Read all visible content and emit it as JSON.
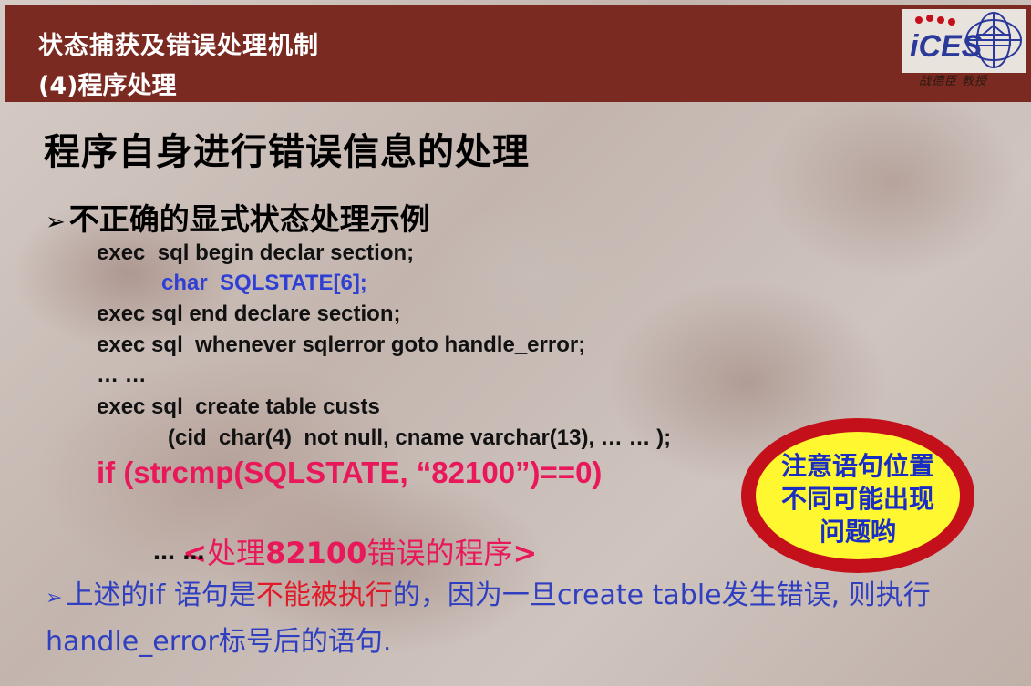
{
  "header": {
    "title": "状态捕获及错误处理机制",
    "subtitle": "(4)程序处理",
    "logo_text": "iCES",
    "logo_caption": "战德臣 教授"
  },
  "main_title": "程序自身进行错误信息的处理",
  "subheading": {
    "arrow": "➢",
    "text": "不正确的显式状态处理示例"
  },
  "code_lines": [
    "exec  sql begin declar section;",
    "char  SQLSTATE[6];",
    "exec sql end declare section;",
    "exec sql  whenever sqlerror goto handle_error;",
    "… …",
    "exec sql  create table custs",
    "(cid  char(4)  not null, cname varchar(13), … … );"
  ],
  "if_line": "if (strcmp(SQLSTATE, “82100”)==0)",
  "handler": {
    "open": "<",
    "part1": "处理",
    "code": "82100",
    "part2": "错误的程序",
    "close": ">"
  },
  "ellipsis": "… …",
  "callout": {
    "line1": "注意语句位置",
    "line2": "不同可能出现",
    "line3": "问题哟"
  },
  "note": {
    "arrow": "➢",
    "part1": "上述的if 语句是",
    "red": "不能被执行",
    "part2": "的，因为一旦create table发生错误, 则执行",
    "part3": "handle_error标号后的语句."
  },
  "colors": {
    "header_bg": "#7b2a22",
    "code_blue": "#2f3fd4",
    "if_pink": "#e8185a",
    "callout_fill": "#fff830",
    "callout_ring": "#c4101a",
    "note_blue": "#2f3fc0",
    "note_red": "#e11a2a"
  }
}
